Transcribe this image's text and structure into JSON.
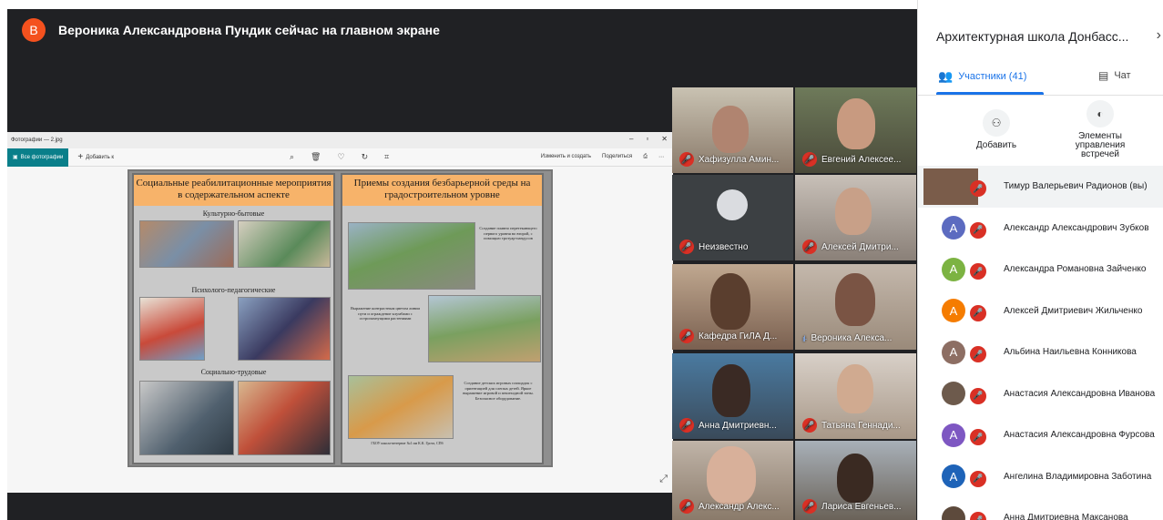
{
  "presenter": {
    "avatar_letter": "В",
    "banner": "Вероника Александровна Пундик сейчас на главном экране"
  },
  "viewer": {
    "file_title": "Фотографии — 2.jpg",
    "window_controls": [
      "–",
      "▫",
      "✕"
    ],
    "all_photos": "Все фотографии",
    "add_to": "Добавить к",
    "edit_create": "Изменить и создать",
    "share": "Поделиться"
  },
  "slide": {
    "left_heading": "Социальные реабилитационные мероприятия в содержательном аспекте",
    "right_heading": "Приемы создания безбарьерной среды на градостроительном уровне",
    "left_sections": [
      "Культурно-бытовые",
      "Психолого-педагогические",
      "Социально-трудовые"
    ],
    "right_captions": [
      "Создание плавно перетекающего первого уровня во второй, с помощью тротуар-пандусов",
      "Выражение контрастным цветом линии пути и ограждение клумбами с остропахнущими растениями",
      "Создание детских игровых площадок с ориентацией для слепых детей. Яркое выражение игровой и пешеходной зоны. Безопасное оборудование."
    ],
    "footnote": "ГБОУ школа-интернат №1 им К.К. Грота, СПб"
  },
  "tiles": [
    {
      "name": "Хафизулла Амин...",
      "muted": true
    },
    {
      "name": "Евгений Алексее...",
      "muted": true
    },
    {
      "name": "Неизвестно",
      "muted": true
    },
    {
      "name": "Алексей Дмитри...",
      "muted": true
    },
    {
      "name": "Кафедра ГиЛА Д...",
      "muted": true
    },
    {
      "name": "Вероника Алекса...",
      "muted": false
    },
    {
      "name": "Анна Дмитриевн...",
      "muted": true
    },
    {
      "name": "Татьяна Геннади...",
      "muted": true
    },
    {
      "name": "Александр Алекс...",
      "muted": true
    },
    {
      "name": "Лариса Евгеньев...",
      "muted": true
    }
  ],
  "panel": {
    "meeting_title": "Архитектурная школа Донбасс...",
    "tab_people": "Участники (41)",
    "tab_chat": "Чат",
    "add_label": "Добавить",
    "controls_label": "Элементы управления встречей",
    "participants": [
      {
        "name": "Тимур Валерьевич Радионов (вы)",
        "letter": "",
        "color": "#7a5c4a"
      },
      {
        "name": "Александр Александрович Зубков",
        "letter": "A",
        "color": "#5c6bc0"
      },
      {
        "name": "Александра Романовна Зайченко",
        "letter": "A",
        "color": "#7cb342"
      },
      {
        "name": "Алексей Дмитриевич Жильченко",
        "letter": "A",
        "color": "#f57c00"
      },
      {
        "name": "Альбина Наильевна Конникова",
        "letter": "A",
        "color": "#8d6e63"
      },
      {
        "name": "Анастасия Александровна Иванова",
        "letter": "",
        "color": "#6d5a4c"
      },
      {
        "name": "Анастасия Александровна Фурсова",
        "letter": "A",
        "color": "#7e57c2"
      },
      {
        "name": "Ангелина Владимировна Заботина",
        "letter": "A",
        "color": "#1e63b8"
      },
      {
        "name": "Анна Дмитриевна Максанова",
        "letter": "",
        "color": "#5d4a3c"
      }
    ]
  }
}
